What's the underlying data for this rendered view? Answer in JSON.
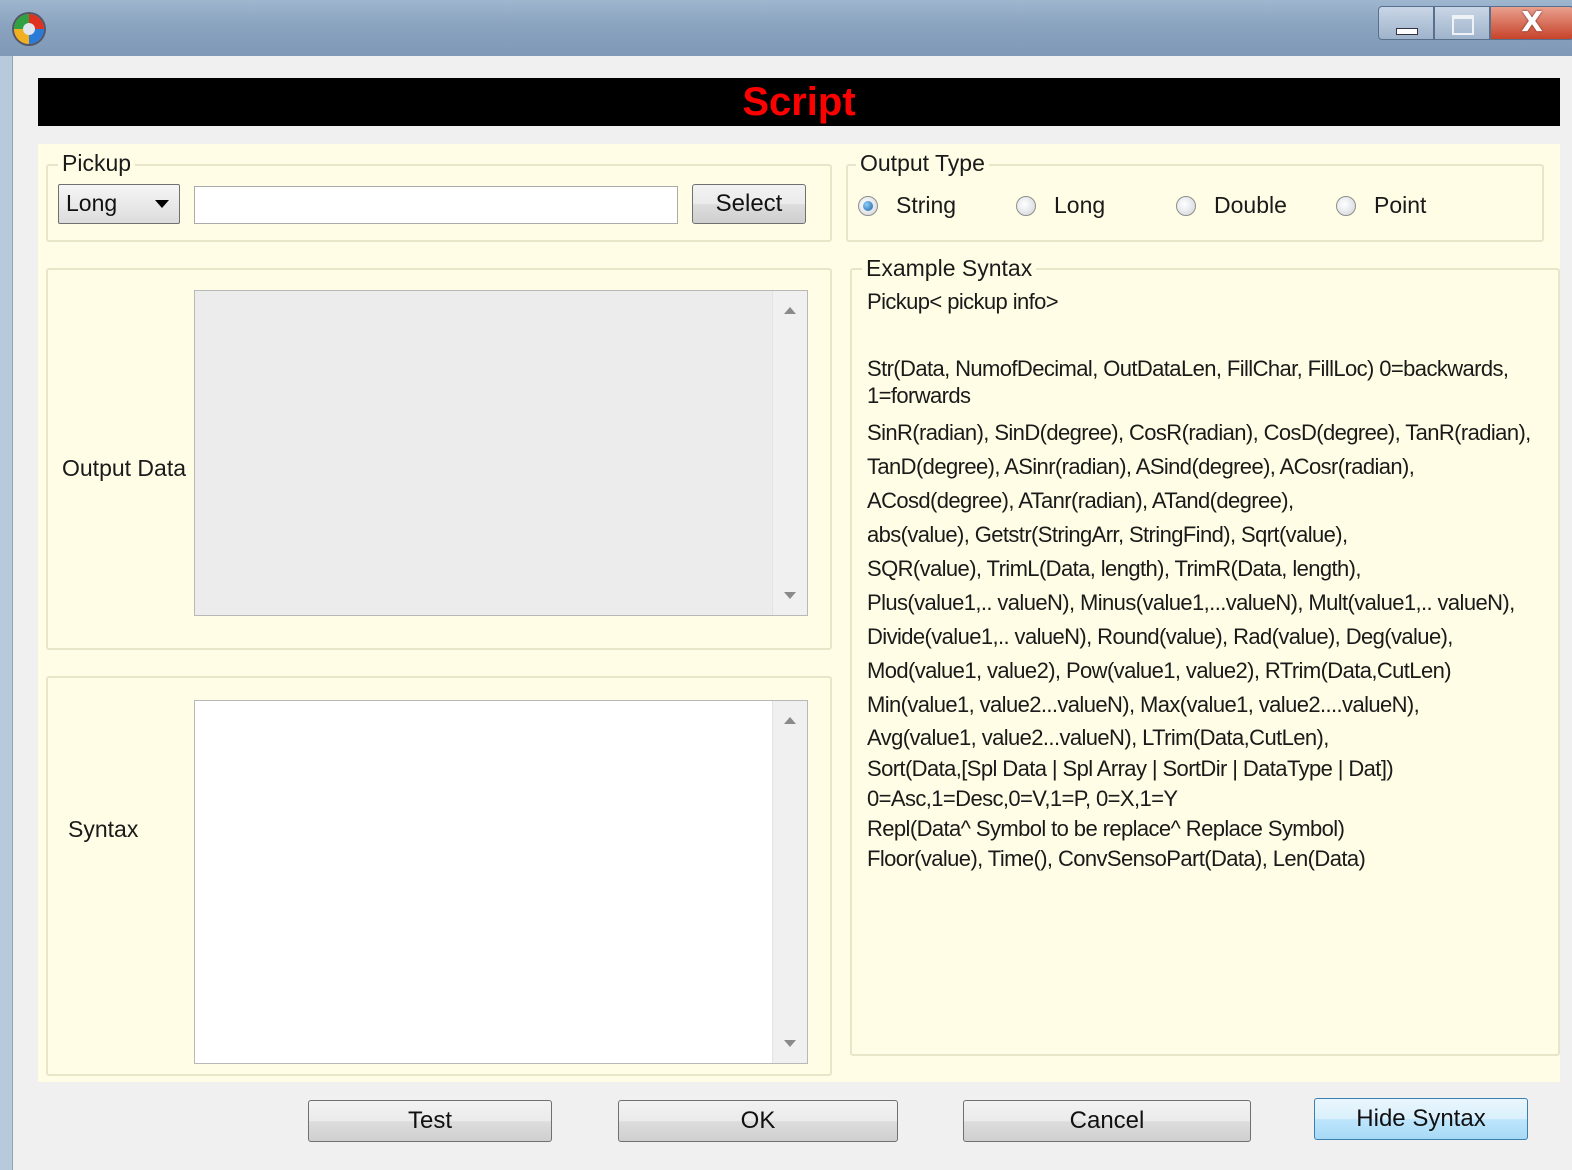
{
  "window": {
    "title": "",
    "close_glyph": "X",
    "icon": "app-logo-icon"
  },
  "banner": {
    "title": "Script",
    "title_color": "#ff0000"
  },
  "pickup": {
    "legend": "Pickup",
    "type_value": "Long",
    "field_value": "",
    "select_label": "Select"
  },
  "output_type": {
    "legend": "Output Type",
    "options": [
      {
        "label": "String",
        "selected": true
      },
      {
        "label": "Long",
        "selected": false
      },
      {
        "label": "Double",
        "selected": false
      },
      {
        "label": "Point",
        "selected": false
      }
    ]
  },
  "output_data": {
    "label": "Output Data",
    "value": ""
  },
  "syntax": {
    "label": "Syntax",
    "value": ""
  },
  "example_syntax": {
    "legend": "Example Syntax",
    "lines": [
      "Pickup< pickup info>",
      "",
      "Str(Data, NumofDecimal, OutDataLen, FillChar, FillLoc) 0=backwards,",
      "1=forwards",
      "SinR(radian), SinD(degree), CosR(radian), CosD(degree), TanR(radian),",
      "TanD(degree), ASinr(radian), ASind(degree), ACosr(radian),",
      "ACosd(degree), ATanr(radian), ATand(degree),",
      "abs(value), Getstr(StringArr, StringFind), Sqrt(value),",
      "SQR(value), TrimL(Data, length), TrimR(Data, length),",
      "Plus(value1,.. valueN), Minus(value1,...valueN), Mult(value1,.. valueN),",
      "Divide(value1,.. valueN), Round(value), Rad(value), Deg(value),",
      "Mod(value1, value2), Pow(value1, value2), RTrim(Data,CutLen)",
      "Min(value1, value2...valueN), Max(value1, value2....valueN),",
      "Avg(value1, value2...valueN), LTrim(Data,CutLen),",
      "Sort(Data,[Spl Data | Spl Array | SortDir | DataType | Dat])",
      "0=Asc,1=Desc,0=V,1=P, 0=X,1=Y",
      "Repl(Data^ Symbol to be replace^ Replace Symbol)",
      "Floor(value), Time(), ConvSensoPart(Data), Len(Data)"
    ]
  },
  "buttons": {
    "test": "Test",
    "ok": "OK",
    "cancel": "Cancel",
    "hide_syntax": "Hide Syntax"
  },
  "colors": {
    "panel_background": "#fffde5",
    "banner_background": "#000000"
  }
}
